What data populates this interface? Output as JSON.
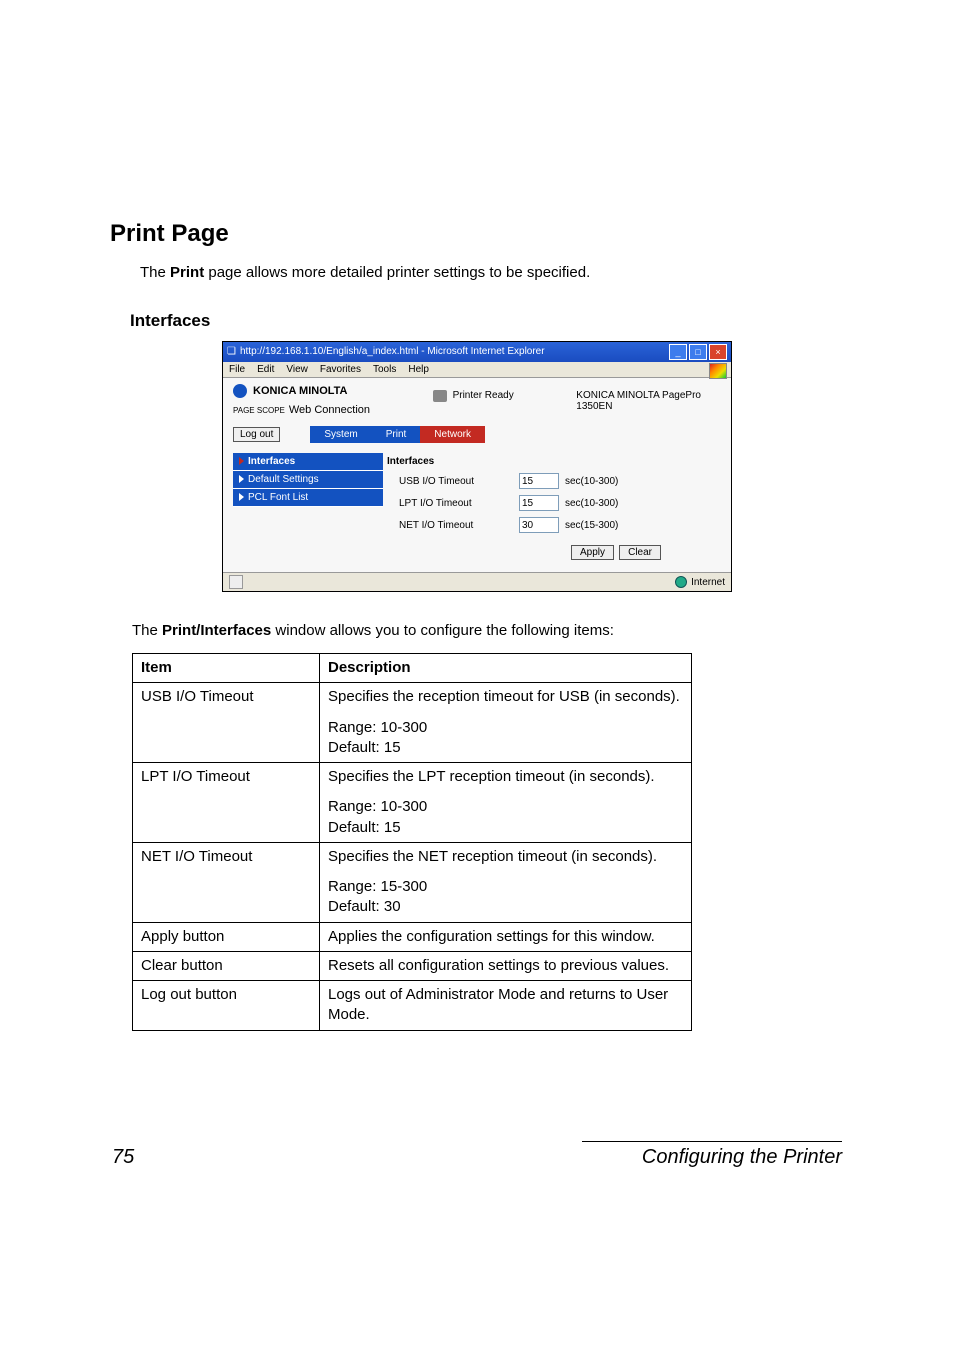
{
  "doc": {
    "h1": "Print Page",
    "intro_pre": "The ",
    "intro_bold": "Print",
    "intro_post": " page allows more detailed printer settings to be specified.",
    "h2": "Interfaces",
    "after_fig_pre": "The ",
    "after_fig_bold": "Print/Interfaces",
    "after_fig_post": " window allows you to configure the following items:",
    "table": {
      "head_item": "Item",
      "head_desc": "Description",
      "rows": [
        {
          "item": "USB I/O Timeout",
          "desc": [
            "Specifies the reception timeout for USB (in seconds).",
            "Range:   10-300\nDefault:  15"
          ]
        },
        {
          "item": "LPT I/O Timeout",
          "desc": [
            "Specifies the LPT reception timeout (in seconds).",
            "Range: 10-300\nDefault: 15"
          ]
        },
        {
          "item": "NET I/O Timeout",
          "desc": [
            "Specifies the NET reception timeout (in seconds).",
            "Range: 15-300\nDefault: 30"
          ]
        },
        {
          "item": "Apply button",
          "desc": [
            "Applies the configuration settings for this window."
          ]
        },
        {
          "item": "Clear button",
          "desc": [
            "Resets all configuration settings to previous values."
          ]
        },
        {
          "item": "Log out button",
          "desc": [
            "Logs out of Administrator Mode and returns to User Mode."
          ]
        }
      ]
    },
    "page_number": "75",
    "running_title": "Configuring the Printer"
  },
  "screenshot": {
    "titlebar": "http://192.168.1.10/English/a_index.html - Microsoft Internet Explorer",
    "menu": [
      "File",
      "Edit",
      "View",
      "Favorites",
      "Tools",
      "Help"
    ],
    "brand1": "KONICA MINOLTA",
    "brand2_pre": "PAGE SCOPE",
    "brand2": "Web Connection",
    "printer_status": "Printer Ready",
    "model_line1": "KONICA MINOLTA PagePro",
    "model_line2": "1350EN",
    "logout": "Log out",
    "nav": {
      "system": "System",
      "print": "Print",
      "network": "Network"
    },
    "sidebar": [
      "Interfaces",
      "Default Settings",
      "PCL Font List"
    ],
    "form": {
      "heading": "Interfaces",
      "rows": [
        {
          "label": "USB I/O Timeout",
          "value": "15",
          "suffix": "sec(10-300)"
        },
        {
          "label": "LPT I/O Timeout",
          "value": "15",
          "suffix": "sec(10-300)"
        },
        {
          "label": "NET I/O Timeout",
          "value": "30",
          "suffix": "sec(15-300)"
        }
      ],
      "apply": "Apply",
      "clear": "Clear"
    },
    "status_zone": "Internet"
  }
}
